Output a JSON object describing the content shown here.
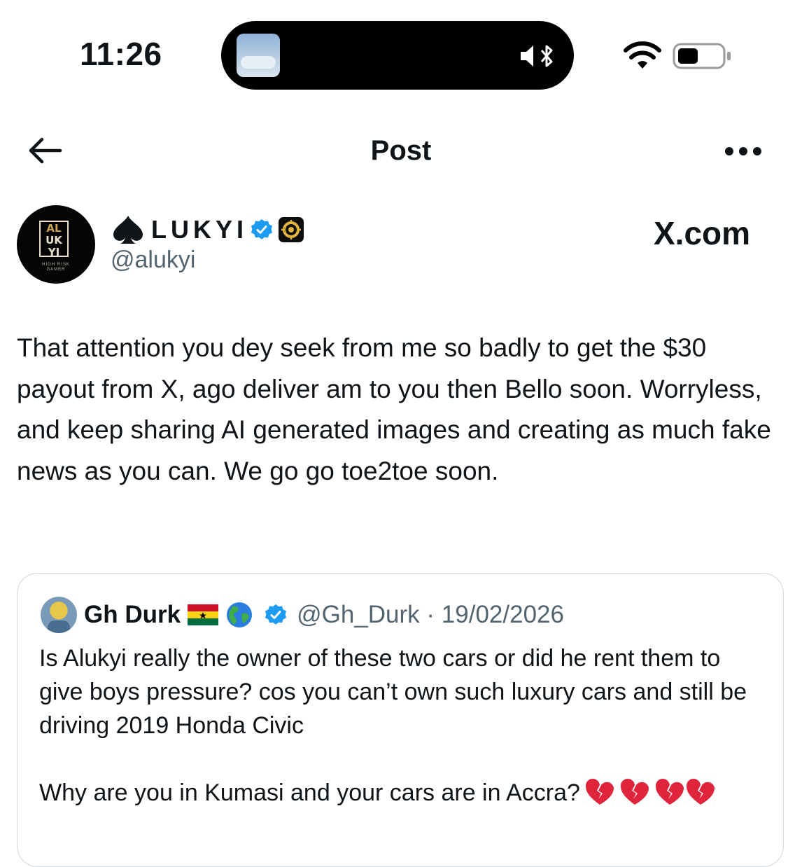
{
  "status_bar": {
    "time": "11:26",
    "icons": [
      "island-photo-thumbnail",
      "silent-mode-icon",
      "bluetooth-icon",
      "wifi-icon",
      "battery-icon"
    ]
  },
  "header": {
    "title": "Post",
    "back_icon": "arrow-left-icon",
    "more_icon": "more-horizontal-icon"
  },
  "author": {
    "prefix_icon": "spade",
    "display_name": "LUKYI",
    "handle": "@alukyi",
    "verified_color": "#1d9bf0",
    "avatar_logo_lines": [
      "AL",
      "UK",
      "YI"
    ],
    "avatar_tagline": "HIGH RISK GAMER"
  },
  "watermark": "X.com",
  "tweet": {
    "text": "That attention you dey seek from me so badly to get the $30 payout from X, ago deliver am to you then Bello soon. Worryless, and keep sharing AI generated images and creating as much fake news as you can. We go go toe2toe soon."
  },
  "quoted": {
    "display_name": "Gh Durk",
    "flag": "ghana-flag",
    "globe": "earth-globe-americas",
    "handle": "@Gh_Durk",
    "separator": "·",
    "date": "19/02/2026",
    "paragraph1": "Is Alukyi really the owner of these two cars or did he rent them to give boys pressure? cos you can’t own such luxury cars and still be driving 2019 Honda Civic",
    "paragraph2": "Why are you in Kumasi and your cars are in Accra?",
    "trailing_emojis": [
      "broken-heart",
      "broken-heart",
      "broken-heart",
      "broken-heart"
    ]
  },
  "colors": {
    "text": "#0f1419",
    "secondary_text": "#536471",
    "border": "#cfd9de",
    "verified": "#1d9bf0",
    "broken_heart": "#e0243b"
  }
}
